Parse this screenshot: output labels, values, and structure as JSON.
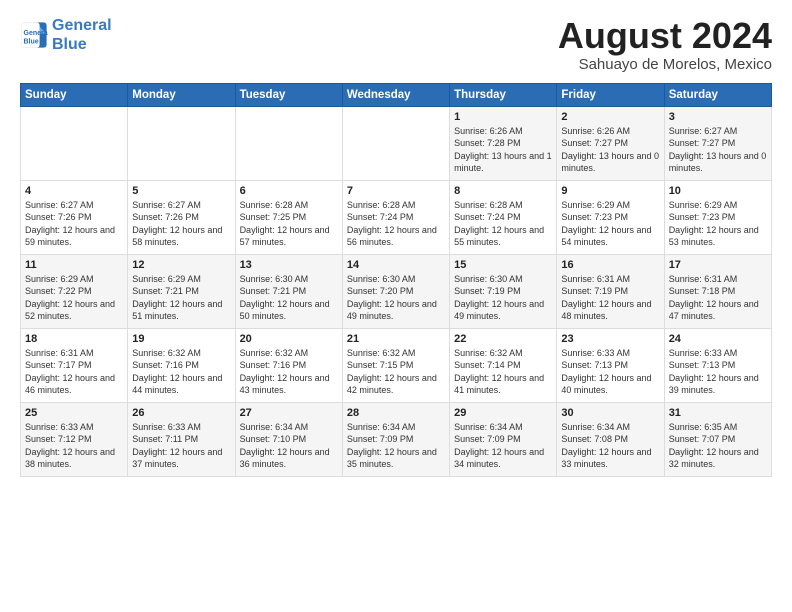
{
  "logo": {
    "line1": "General",
    "line2": "Blue"
  },
  "title": "August 2024",
  "subtitle": "Sahuayo de Morelos, Mexico",
  "days_of_week": [
    "Sunday",
    "Monday",
    "Tuesday",
    "Wednesday",
    "Thursday",
    "Friday",
    "Saturday"
  ],
  "weeks": [
    [
      {
        "day": "",
        "sunrise": "",
        "sunset": "",
        "daylight": ""
      },
      {
        "day": "",
        "sunrise": "",
        "sunset": "",
        "daylight": ""
      },
      {
        "day": "",
        "sunrise": "",
        "sunset": "",
        "daylight": ""
      },
      {
        "day": "",
        "sunrise": "",
        "sunset": "",
        "daylight": ""
      },
      {
        "day": "1",
        "sunrise": "Sunrise: 6:26 AM",
        "sunset": "Sunset: 7:28 PM",
        "daylight": "Daylight: 13 hours and 1 minute."
      },
      {
        "day": "2",
        "sunrise": "Sunrise: 6:26 AM",
        "sunset": "Sunset: 7:27 PM",
        "daylight": "Daylight: 13 hours and 0 minutes."
      },
      {
        "day": "3",
        "sunrise": "Sunrise: 6:27 AM",
        "sunset": "Sunset: 7:27 PM",
        "daylight": "Daylight: 13 hours and 0 minutes."
      }
    ],
    [
      {
        "day": "4",
        "sunrise": "Sunrise: 6:27 AM",
        "sunset": "Sunset: 7:26 PM",
        "daylight": "Daylight: 12 hours and 59 minutes."
      },
      {
        "day": "5",
        "sunrise": "Sunrise: 6:27 AM",
        "sunset": "Sunset: 7:26 PM",
        "daylight": "Daylight: 12 hours and 58 minutes."
      },
      {
        "day": "6",
        "sunrise": "Sunrise: 6:28 AM",
        "sunset": "Sunset: 7:25 PM",
        "daylight": "Daylight: 12 hours and 57 minutes."
      },
      {
        "day": "7",
        "sunrise": "Sunrise: 6:28 AM",
        "sunset": "Sunset: 7:24 PM",
        "daylight": "Daylight: 12 hours and 56 minutes."
      },
      {
        "day": "8",
        "sunrise": "Sunrise: 6:28 AM",
        "sunset": "Sunset: 7:24 PM",
        "daylight": "Daylight: 12 hours and 55 minutes."
      },
      {
        "day": "9",
        "sunrise": "Sunrise: 6:29 AM",
        "sunset": "Sunset: 7:23 PM",
        "daylight": "Daylight: 12 hours and 54 minutes."
      },
      {
        "day": "10",
        "sunrise": "Sunrise: 6:29 AM",
        "sunset": "Sunset: 7:23 PM",
        "daylight": "Daylight: 12 hours and 53 minutes."
      }
    ],
    [
      {
        "day": "11",
        "sunrise": "Sunrise: 6:29 AM",
        "sunset": "Sunset: 7:22 PM",
        "daylight": "Daylight: 12 hours and 52 minutes."
      },
      {
        "day": "12",
        "sunrise": "Sunrise: 6:29 AM",
        "sunset": "Sunset: 7:21 PM",
        "daylight": "Daylight: 12 hours and 51 minutes."
      },
      {
        "day": "13",
        "sunrise": "Sunrise: 6:30 AM",
        "sunset": "Sunset: 7:21 PM",
        "daylight": "Daylight: 12 hours and 50 minutes."
      },
      {
        "day": "14",
        "sunrise": "Sunrise: 6:30 AM",
        "sunset": "Sunset: 7:20 PM",
        "daylight": "Daylight: 12 hours and 49 minutes."
      },
      {
        "day": "15",
        "sunrise": "Sunrise: 6:30 AM",
        "sunset": "Sunset: 7:19 PM",
        "daylight": "Daylight: 12 hours and 49 minutes."
      },
      {
        "day": "16",
        "sunrise": "Sunrise: 6:31 AM",
        "sunset": "Sunset: 7:19 PM",
        "daylight": "Daylight: 12 hours and 48 minutes."
      },
      {
        "day": "17",
        "sunrise": "Sunrise: 6:31 AM",
        "sunset": "Sunset: 7:18 PM",
        "daylight": "Daylight: 12 hours and 47 minutes."
      }
    ],
    [
      {
        "day": "18",
        "sunrise": "Sunrise: 6:31 AM",
        "sunset": "Sunset: 7:17 PM",
        "daylight": "Daylight: 12 hours and 46 minutes."
      },
      {
        "day": "19",
        "sunrise": "Sunrise: 6:32 AM",
        "sunset": "Sunset: 7:16 PM",
        "daylight": "Daylight: 12 hours and 44 minutes."
      },
      {
        "day": "20",
        "sunrise": "Sunrise: 6:32 AM",
        "sunset": "Sunset: 7:16 PM",
        "daylight": "Daylight: 12 hours and 43 minutes."
      },
      {
        "day": "21",
        "sunrise": "Sunrise: 6:32 AM",
        "sunset": "Sunset: 7:15 PM",
        "daylight": "Daylight: 12 hours and 42 minutes."
      },
      {
        "day": "22",
        "sunrise": "Sunrise: 6:32 AM",
        "sunset": "Sunset: 7:14 PM",
        "daylight": "Daylight: 12 hours and 41 minutes."
      },
      {
        "day": "23",
        "sunrise": "Sunrise: 6:33 AM",
        "sunset": "Sunset: 7:13 PM",
        "daylight": "Daylight: 12 hours and 40 minutes."
      },
      {
        "day": "24",
        "sunrise": "Sunrise: 6:33 AM",
        "sunset": "Sunset: 7:13 PM",
        "daylight": "Daylight: 12 hours and 39 minutes."
      }
    ],
    [
      {
        "day": "25",
        "sunrise": "Sunrise: 6:33 AM",
        "sunset": "Sunset: 7:12 PM",
        "daylight": "Daylight: 12 hours and 38 minutes."
      },
      {
        "day": "26",
        "sunrise": "Sunrise: 6:33 AM",
        "sunset": "Sunset: 7:11 PM",
        "daylight": "Daylight: 12 hours and 37 minutes."
      },
      {
        "day": "27",
        "sunrise": "Sunrise: 6:34 AM",
        "sunset": "Sunset: 7:10 PM",
        "daylight": "Daylight: 12 hours and 36 minutes."
      },
      {
        "day": "28",
        "sunrise": "Sunrise: 6:34 AM",
        "sunset": "Sunset: 7:09 PM",
        "daylight": "Daylight: 12 hours and 35 minutes."
      },
      {
        "day": "29",
        "sunrise": "Sunrise: 6:34 AM",
        "sunset": "Sunset: 7:09 PM",
        "daylight": "Daylight: 12 hours and 34 minutes."
      },
      {
        "day": "30",
        "sunrise": "Sunrise: 6:34 AM",
        "sunset": "Sunset: 7:08 PM",
        "daylight": "Daylight: 12 hours and 33 minutes."
      },
      {
        "day": "31",
        "sunrise": "Sunrise: 6:35 AM",
        "sunset": "Sunset: 7:07 PM",
        "daylight": "Daylight: 12 hours and 32 minutes."
      }
    ]
  ]
}
